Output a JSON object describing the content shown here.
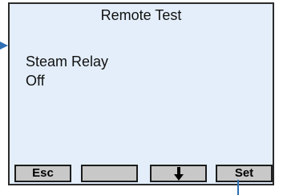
{
  "screen": {
    "title": "Remote Test",
    "lines": [
      "Steam Relay",
      "Off"
    ],
    "background_color": "#e3eefa"
  },
  "softkeys": [
    {
      "label": "Esc",
      "icon": null
    },
    {
      "label": "",
      "icon": null
    },
    {
      "label": "",
      "icon": "down-arrow-icon"
    },
    {
      "label": "Set",
      "icon": null
    }
  ],
  "callout_color": "#2e6fb4"
}
